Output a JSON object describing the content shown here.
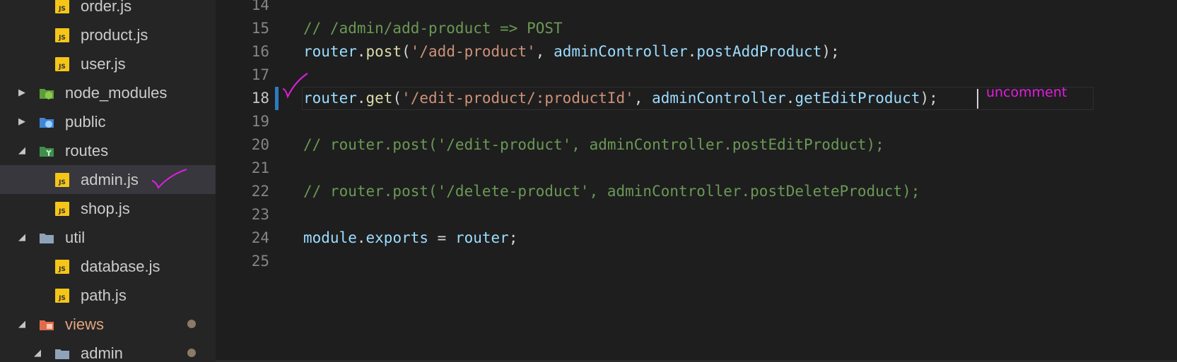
{
  "sidebar": {
    "items": [
      {
        "label": "order.js",
        "kind": "file",
        "icon": "js-file-icon"
      },
      {
        "label": "product.js",
        "kind": "file",
        "icon": "js-file-icon"
      },
      {
        "label": "user.js",
        "kind": "file",
        "icon": "js-file-icon"
      },
      {
        "label": "node_modules",
        "kind": "folder",
        "icon": "node-folder-icon",
        "expanded": false
      },
      {
        "label": "public",
        "kind": "folder",
        "icon": "public-folder-icon",
        "expanded": false
      },
      {
        "label": "routes",
        "kind": "folder",
        "icon": "routes-folder-icon",
        "expanded": true
      },
      {
        "label": "admin.js",
        "kind": "file",
        "icon": "js-file-icon",
        "selected": true
      },
      {
        "label": "shop.js",
        "kind": "file",
        "icon": "js-file-icon"
      },
      {
        "label": "util",
        "kind": "folder",
        "icon": "folder-icon",
        "expanded": true
      },
      {
        "label": "database.js",
        "kind": "file",
        "icon": "js-file-icon"
      },
      {
        "label": "path.js",
        "kind": "file",
        "icon": "js-file-icon"
      },
      {
        "label": "views",
        "kind": "folder",
        "icon": "views-folder-icon",
        "expanded": true,
        "modified": true
      },
      {
        "label": "admin",
        "kind": "folder",
        "icon": "folder-icon",
        "expanded": true,
        "modified": true
      }
    ]
  },
  "editor": {
    "lines": [
      {
        "num": "14",
        "text": ""
      },
      {
        "num": "15",
        "text": "// /admin/add-product => POST"
      },
      {
        "num": "16",
        "text": "router.post('/add-product', adminController.postAddProduct);"
      },
      {
        "num": "17",
        "text": ""
      },
      {
        "num": "18",
        "text": "router.get('/edit-product/:productId', adminController.getEditProduct);"
      },
      {
        "num": "19",
        "text": ""
      },
      {
        "num": "20",
        "text": "// router.post('/edit-product', adminController.postEditProduct);"
      },
      {
        "num": "21",
        "text": ""
      },
      {
        "num": "22",
        "text": "// router.post('/delete-product', adminController.postDeleteProduct);"
      },
      {
        "num": "23",
        "text": ""
      },
      {
        "num": "24",
        "text": "module.exports = router;"
      },
      {
        "num": "25",
        "text": ""
      }
    ],
    "active_line": "18",
    "annotation": "uncomment"
  },
  "colors": {
    "sidebar_bg": "#252526",
    "editor_bg": "#1e1e1e",
    "comment": "#6a9955",
    "string": "#ce9178",
    "function": "#dcdcaa",
    "variable": "#9cdcfe",
    "annotation": "#e21de0",
    "js_icon": "#f5c518",
    "gutter_mark": "#2b7bc0"
  }
}
